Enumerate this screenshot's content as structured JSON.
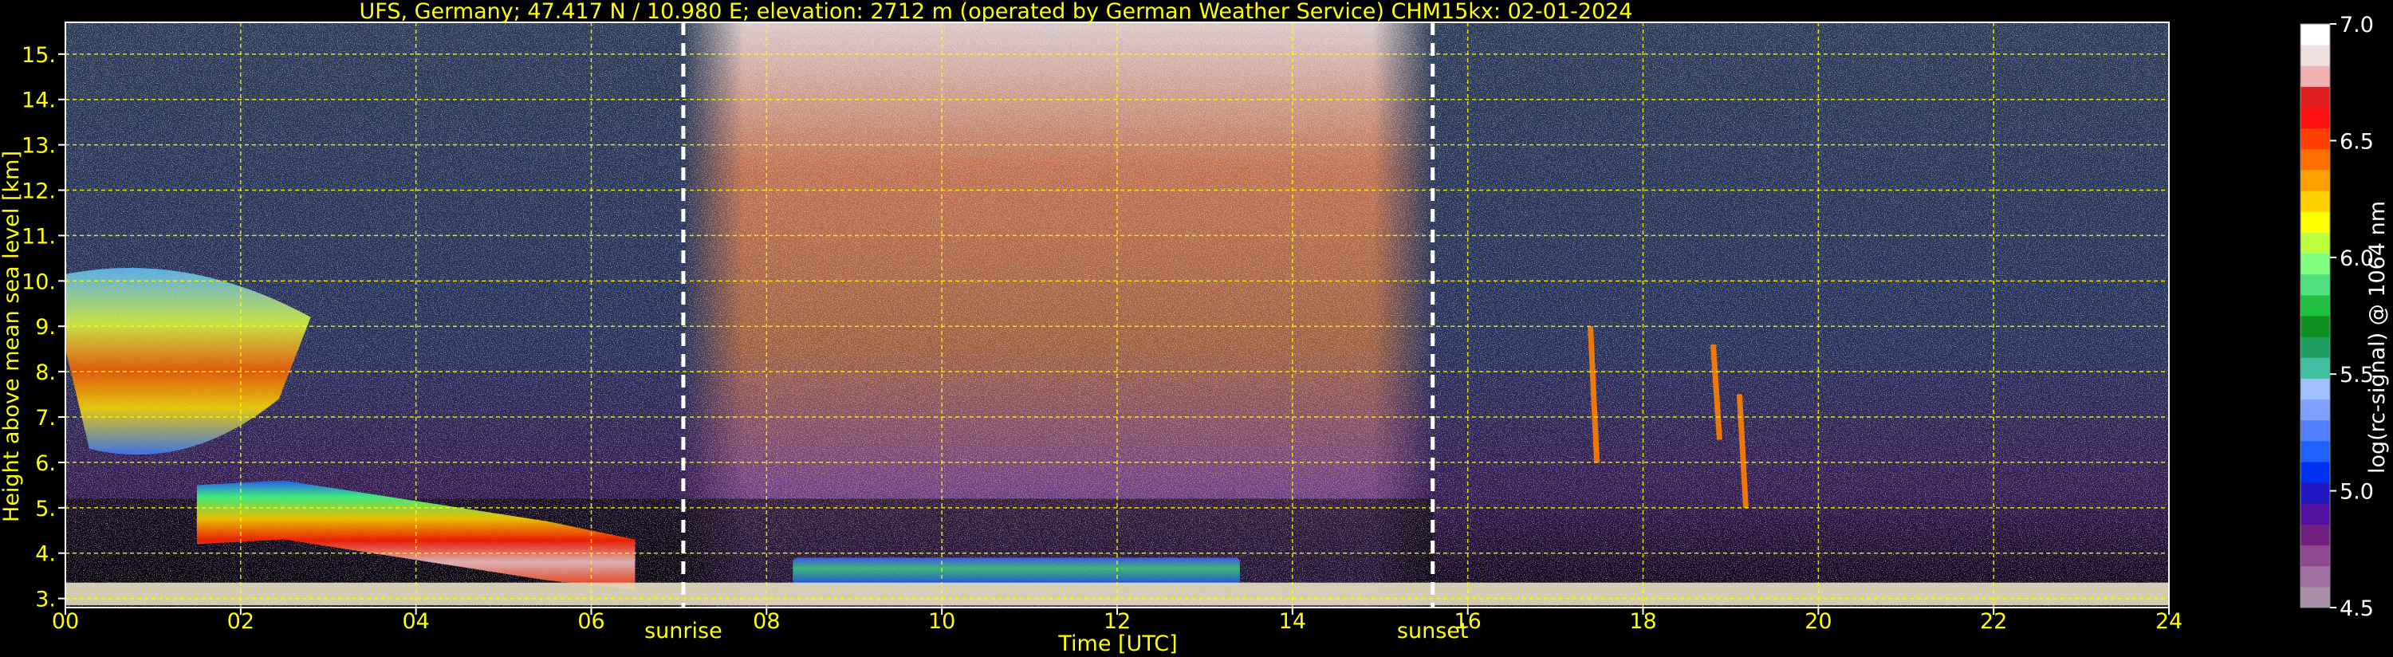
{
  "chart_data": {
    "type": "heatmap",
    "title": "UFS, Germany; 47.417 N / 10.980 E; elevation: 2712 m  (operated by German Weather Service)    CHM15kx: 02-01-2024",
    "xlabel": "Time [UTC]",
    "ylabel": "Height above mean sea level [km]",
    "xlim": [
      0,
      24
    ],
    "ylim": [
      2.8,
      15.7
    ],
    "x_ticks": [
      0,
      2,
      4,
      6,
      8,
      10,
      12,
      14,
      16,
      18,
      20,
      22,
      24
    ],
    "x_tick_labels": [
      "00",
      "02",
      "04",
      "06",
      "08",
      "10",
      "12",
      "14",
      "16",
      "18",
      "20",
      "22",
      "24"
    ],
    "y_ticks": [
      3,
      4,
      5,
      6,
      7,
      8,
      9,
      10,
      11,
      12,
      13,
      14,
      15
    ],
    "y_tick_labels": [
      "3.",
      "4.",
      "5.",
      "6.",
      "7.",
      "8.",
      "9.",
      "10.",
      "11.",
      "12.",
      "13.",
      "14.",
      "15."
    ],
    "grid": true,
    "annotations": [
      {
        "label": "sunrise",
        "x": 7.05
      },
      {
        "label": "sunset",
        "x": 15.6
      }
    ],
    "colorbar": {
      "label": "log(rc-signal) @ 1064 nm",
      "range": [
        4.5,
        7.0
      ],
      "ticks": [
        4.5,
        5.0,
        5.5,
        6.0,
        6.5,
        7.0
      ],
      "tick_labels": [
        "4.5",
        "5.0",
        "5.5",
        "6.0",
        "6.5",
        "7.0"
      ],
      "colors": [
        "#a890a8",
        "#a070a0",
        "#904890",
        "#702080",
        "#5010a0",
        "#2018c0",
        "#0030f0",
        "#2060ff",
        "#5080ff",
        "#80a0ff",
        "#a0c0ff",
        "#40c0a0",
        "#20a060",
        "#109020",
        "#20c040",
        "#50e080",
        "#80ff80",
        "#c0ff40",
        "#ffff00",
        "#ffd000",
        "#ffa000",
        "#ff7000",
        "#ff4000",
        "#ff1010",
        "#e02020",
        "#f0b0b0",
        "#f0e0e0",
        "#ffffff"
      ]
    },
    "features": [
      {
        "type": "cirrus",
        "x_range": [
          0,
          2.8
        ],
        "y_range": [
          6.3,
          10.5
        ]
      },
      {
        "type": "aerosol_layer_top",
        "x": [
          1.5,
          2.5,
          3.5,
          4.5,
          5.5,
          6.5
        ],
        "y": [
          5.5,
          5.6,
          5.3,
          5.0,
          4.7,
          4.3
        ]
      },
      {
        "type": "boundary_layer",
        "x_range": [
          8.3,
          13.4
        ],
        "y_range": [
          3.3,
          3.9
        ]
      },
      {
        "type": "virga_streaks",
        "x": [
          17.4,
          18.8,
          19.1
        ],
        "y_top": [
          9.0,
          8.6,
          7.5
        ],
        "y_bottom": [
          6.0,
          6.5,
          5.0
        ]
      },
      {
        "type": "surface_signal",
        "x_range": [
          0,
          24
        ],
        "y_range": [
          2.85,
          3.35
        ]
      }
    ]
  }
}
